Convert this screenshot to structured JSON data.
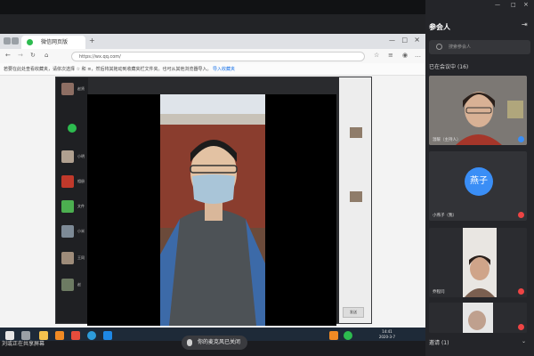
{
  "browser": {
    "tab_title": "微信网页版",
    "url": "https://wx.qq.com/",
    "favbar_text": "若要在此处查看收藏夹，请依次选择 ☆ 和 ≡，然后将其拖动到收藏夹栏文件夹。也可从其他浏览器导入。",
    "favbar_link": "导入收藏夹"
  },
  "chat": {
    "contacts": [
      "赵贤",
      "小明",
      "相册",
      "文件",
      "小米",
      "王同",
      "赵"
    ],
    "send_label": "发送"
  },
  "taskbar": {
    "time": "14:41",
    "date": "2020-3-7"
  },
  "footer": {
    "share_status": "刘或正在共享屏幕",
    "mic_status": "你的麦克风已关闭"
  },
  "panel": {
    "title": "参会人",
    "search_placeholder": "搜索参会人",
    "in_meeting_label": "已在会议中",
    "in_meeting_count": "(16)",
    "participants": [
      {
        "name": "温暖（主持人）",
        "avatar": "",
        "mic": "on"
      },
      {
        "name": "小燕子（我）",
        "avatar": "燕子",
        "mic": "off"
      },
      {
        "name": "乔程闫",
        "avatar": "",
        "mic": "off"
      },
      {
        "name": "",
        "avatar": "",
        "mic": "off"
      }
    ],
    "invite_label": "邀请",
    "invite_count": "(1)"
  },
  "colors": {
    "accent_blue": "#3a8ef6",
    "mic_off_red": "#e44444",
    "panel_bg": "#242529"
  }
}
